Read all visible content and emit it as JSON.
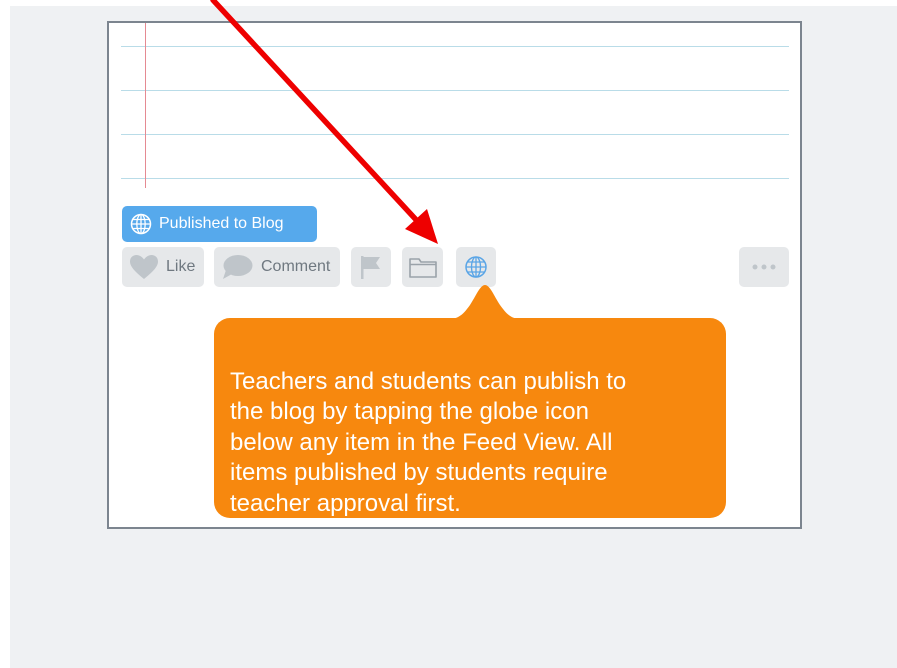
{
  "published_badge": {
    "label": "Published to Blog",
    "icon": "globe-icon"
  },
  "actions": {
    "like_label": "Like",
    "like_icon": "heart-icon",
    "comment_label": "Comment",
    "comment_icon": "speech-bubble-icon",
    "flag_icon": "flag-icon",
    "folder_icon": "folder-icon",
    "globe_icon": "globe-icon",
    "more_icon": "ellipsis-icon"
  },
  "tooltip": {
    "text": "Teachers and students can publish to\nthe blog by tapping the globe icon\nbelow any item in the Feed View. All\nitems published by students require\nteacher approval first."
  },
  "colors": {
    "page_bg": "#eff1f3",
    "badge_blue": "#56a9ec",
    "button_gray": "#e6e8ea",
    "tooltip_orange": "#f7880e",
    "arrow_red": "#ee0000",
    "rule_blue": "#b9dce8",
    "margin_red": "#e58a92"
  }
}
